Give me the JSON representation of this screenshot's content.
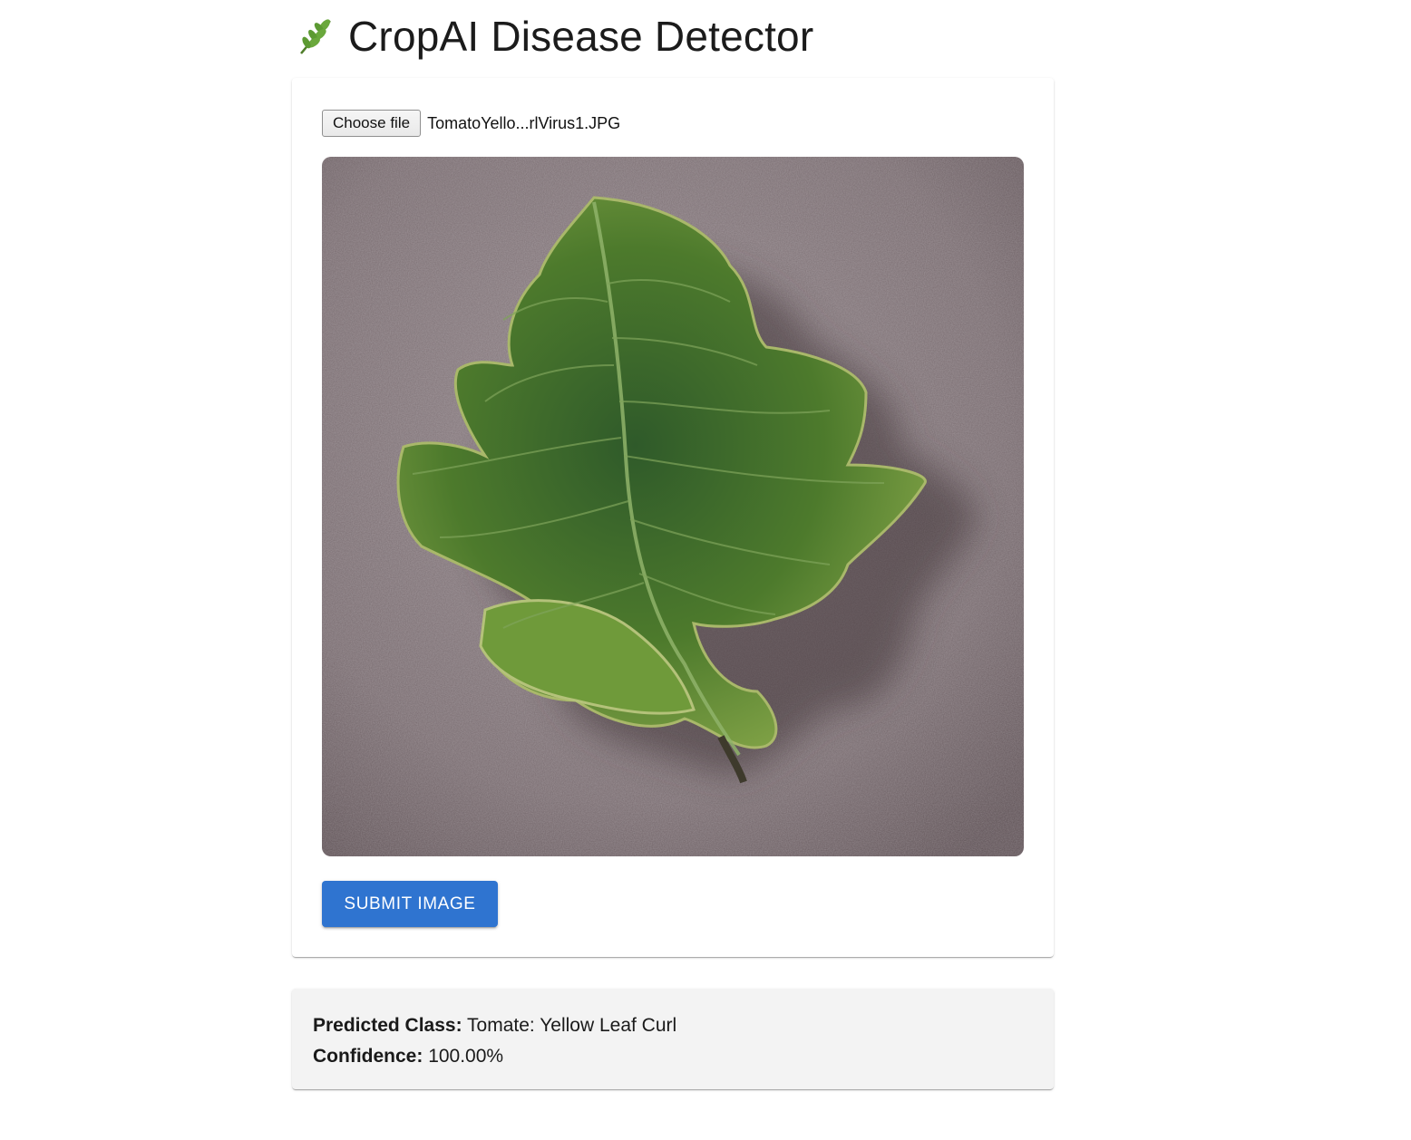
{
  "header": {
    "icon": "herb-leaf-icon",
    "title": "CropAI Disease Detector"
  },
  "upload": {
    "choose_label": "Choose file",
    "file_name": "TomatoYello...rlVirus1.JPG"
  },
  "preview": {
    "icon": "leaf-photo"
  },
  "actions": {
    "submit_label": "Submit Image"
  },
  "result": {
    "class_label": "Predicted Class:",
    "class_value": "Tomate: Yellow Leaf Curl",
    "confidence_label": "Confidence:",
    "confidence_value": "100.00%"
  },
  "colors": {
    "accent": "#2f74d0",
    "result_bg": "#f3f3f3"
  }
}
